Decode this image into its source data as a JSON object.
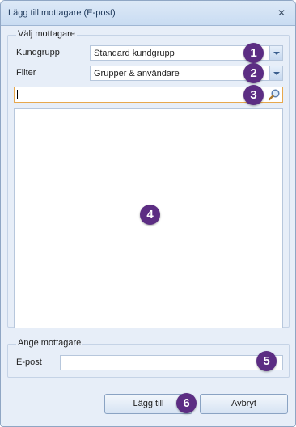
{
  "window": {
    "title": "Lägg till mottagare (E-post)",
    "close_symbol": "✕"
  },
  "select_group": {
    "legend": "Välj mottagare",
    "customer_group": {
      "label": "Kundgrupp",
      "value": "Standard kundgrupp"
    },
    "filter": {
      "label": "Filter",
      "value": "Grupper & användare"
    },
    "search": {
      "value": ""
    }
  },
  "recipient_group": {
    "legend": "Ange mottagare",
    "email": {
      "label": "E-post",
      "value": ""
    }
  },
  "buttons": {
    "add": "Lägg till",
    "cancel": "Avbryt"
  },
  "badges": [
    "1",
    "2",
    "3",
    "4",
    "5",
    "6"
  ],
  "colors": {
    "badge": "#5c2d83",
    "search_focus_border": "#e7a84d",
    "client_bg": "#e7eef8"
  }
}
